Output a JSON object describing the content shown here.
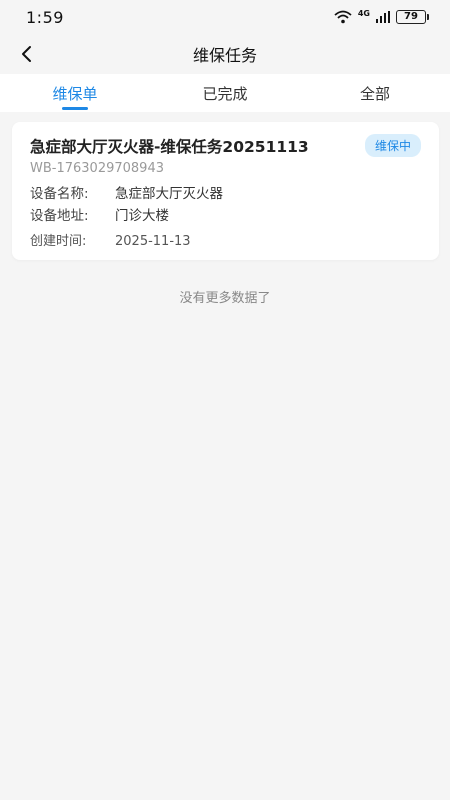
{
  "status_bar": {
    "time": "1:59",
    "network": "4G",
    "battery": "79"
  },
  "nav": {
    "title": "维保任务"
  },
  "tabs": [
    {
      "label": "维保单",
      "active": true
    },
    {
      "label": "已完成",
      "active": false
    },
    {
      "label": "全部",
      "active": false
    }
  ],
  "task": {
    "title": "急症部大厅灭火器-维保任务20251113",
    "status": "维保中",
    "code": "WB-1763029708943",
    "device_name_label": "设备名称:",
    "device_name": "急症部大厅灭火器",
    "device_address_label": "设备地址:",
    "device_address": "门诊大楼",
    "created_label": "创建时间:",
    "created": "2025-11-13"
  },
  "list_footer": "没有更多数据了",
  "colors": {
    "accent": "#1e88e5",
    "badge_bg": "#d9eefc",
    "page_bg": "#f5f5f5"
  }
}
